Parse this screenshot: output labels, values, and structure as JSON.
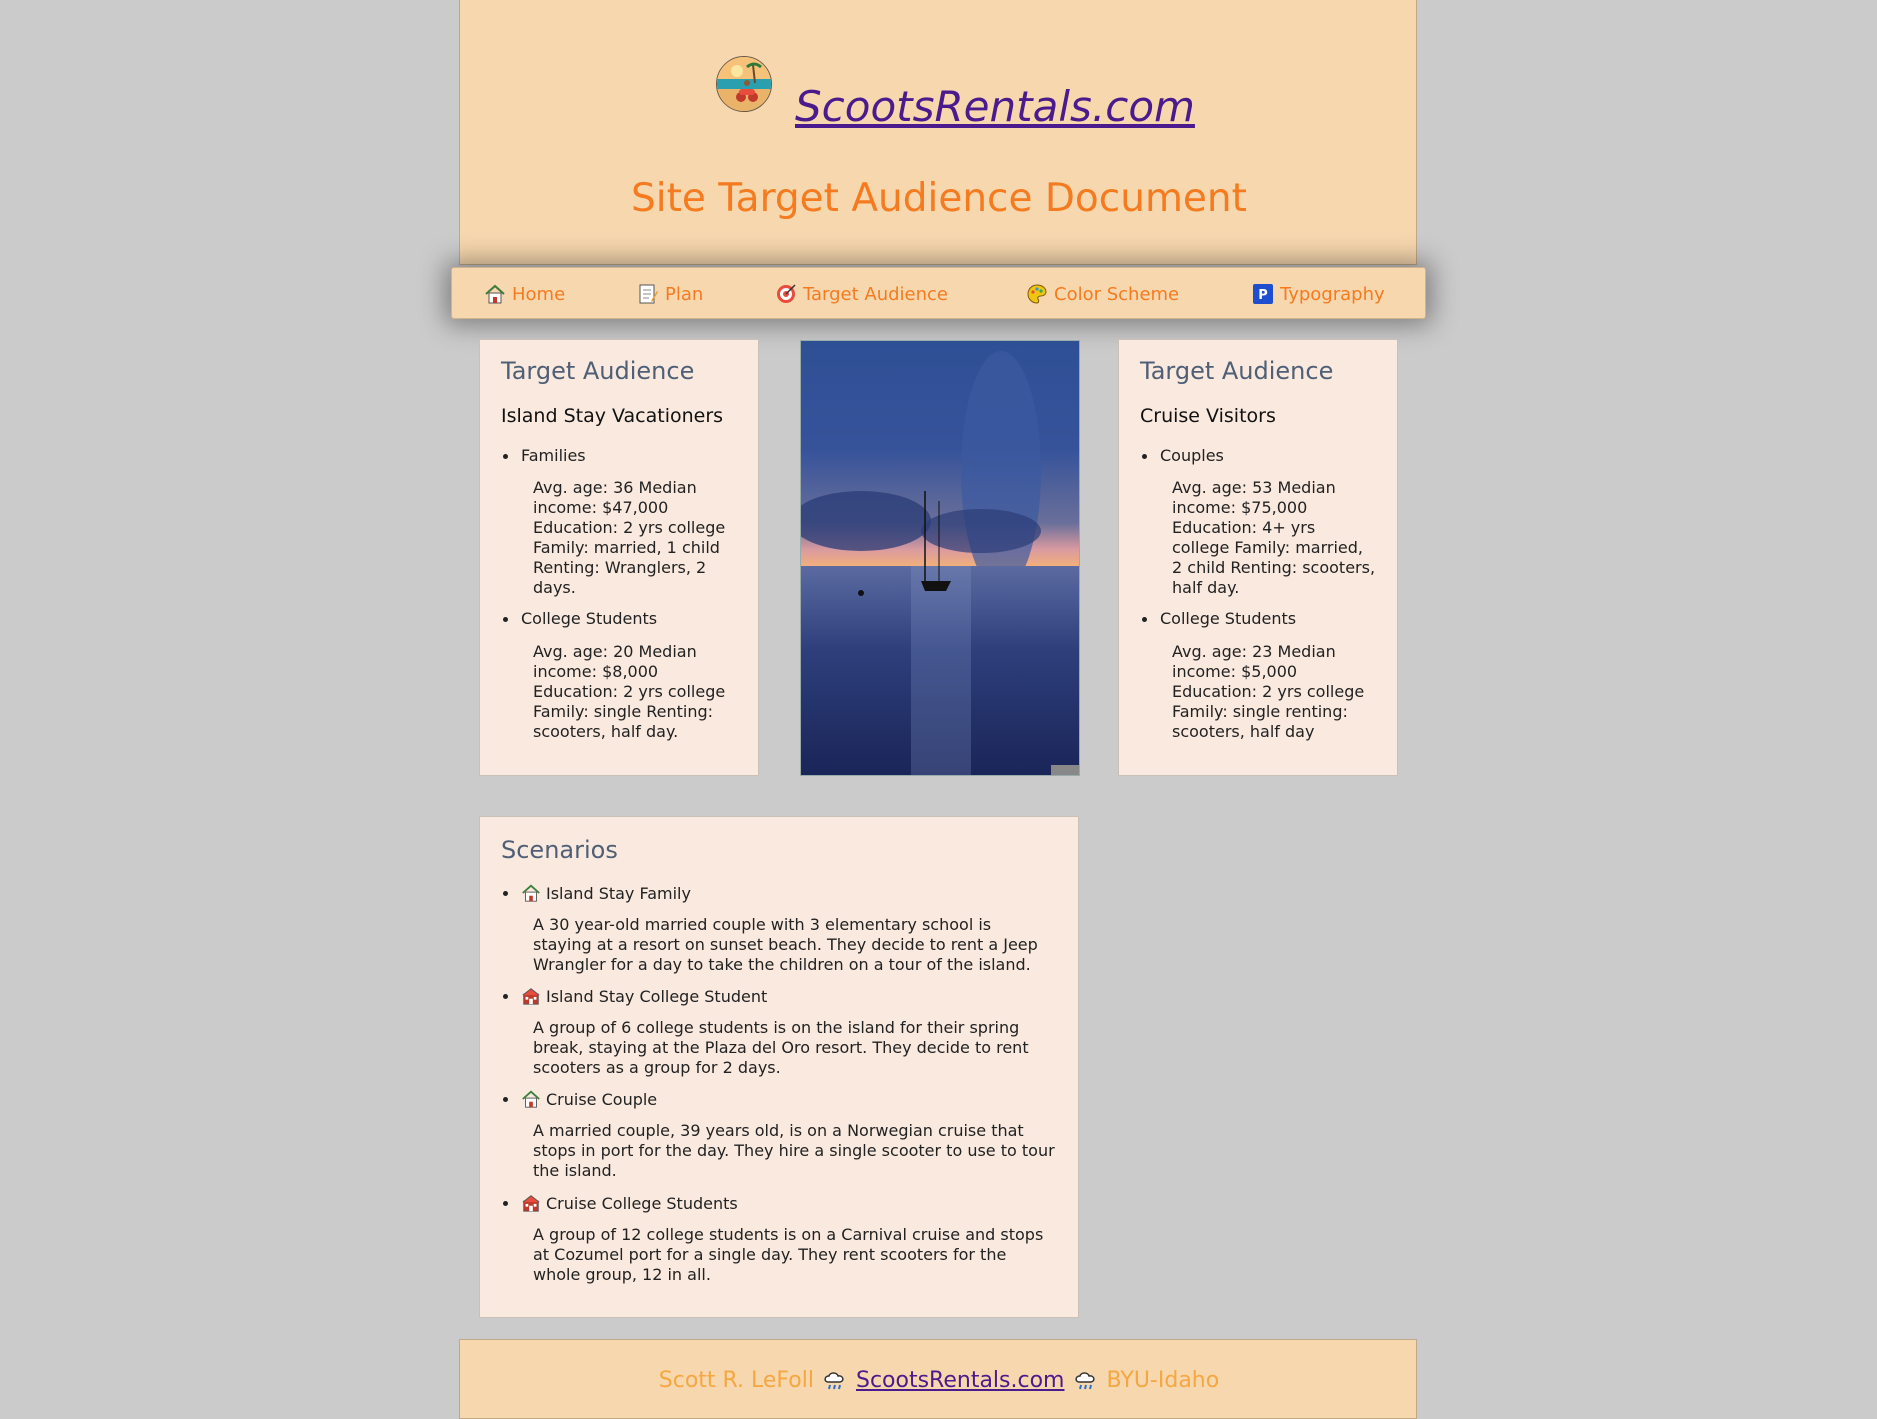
{
  "header": {
    "site_name": "ScootsRentals.com",
    "doc_title": "Site Target Audience Document"
  },
  "nav": [
    {
      "label": "Home",
      "icon": "house-icon"
    },
    {
      "label": "Plan",
      "icon": "memo-icon"
    },
    {
      "label": "Target Audience",
      "icon": "target-icon"
    },
    {
      "label": "Color Scheme",
      "icon": "palette-icon"
    },
    {
      "label": "Typography",
      "icon": "parking-p-icon"
    }
  ],
  "left_card": {
    "heading": "Target Audience",
    "subheading": "Island Stay Vacationers",
    "groups": [
      {
        "label": "Families",
        "desc": "Avg. age: 36 Median income: $47,000 Education: 2 yrs college Family: married, 1 child Renting: Wranglers, 2 days."
      },
      {
        "label": "College Students",
        "desc": "Avg. age: 20 Median income: $8,000 Education: 2 yrs college Family: single Renting: scooters, half day."
      }
    ]
  },
  "right_card": {
    "heading": "Target Audience",
    "subheading": "Cruise Visitors",
    "groups": [
      {
        "label": "Couples",
        "desc": "Avg. age: 53 Median income: $75,000 Education: 4+ yrs college Family: married, 2 child Renting: scooters, half day."
      },
      {
        "label": "College Students",
        "desc": "Avg. age: 23 Median income: $5,000 Education: 2 yrs college Family: single renting: scooters, half day"
      }
    ]
  },
  "scenarios": {
    "heading": "Scenarios",
    "items": [
      {
        "label": "Island Stay Family",
        "icon": "house-icon",
        "desc": "A 30 year-old married couple with 3 elementary school is staying at a resort on sunset beach. They decide to rent a Jeep Wrangler for a day to take the children on a tour of the island."
      },
      {
        "label": "Island Stay College Student",
        "icon": "school-icon",
        "desc": "A group of 6 college students is on the island for their spring break, staying at the Plaza del Oro resort. They decide to rent scooters as a group for 2 days."
      },
      {
        "label": "Cruise Couple",
        "icon": "house-icon",
        "desc": "A married couple, 39 years old, is on a Norwegian cruise that stops in port for the day. They hire a single scooter to use to tour the island."
      },
      {
        "label": "Cruise College Students",
        "icon": "school-icon",
        "desc": "A group of 12 college students is on a Carnival cruise and stops at Cozumel port for a single day. They rent scooters for the whole group, 12 in all."
      }
    ]
  },
  "footer": {
    "author": "Scott R. LeFoll",
    "site_link": "ScootsRentals.com",
    "school": "BYU-Idaho",
    "separator_icon": "cloud-rain-icon"
  },
  "colors": {
    "page_bg": "#cbcbcb",
    "header_bg": "#f7d7ae",
    "accent_orange": "#f47b20",
    "link_purple": "#4b1a8c",
    "card_bg": "#f9e9df",
    "heading_slate": "#4f5f76"
  }
}
